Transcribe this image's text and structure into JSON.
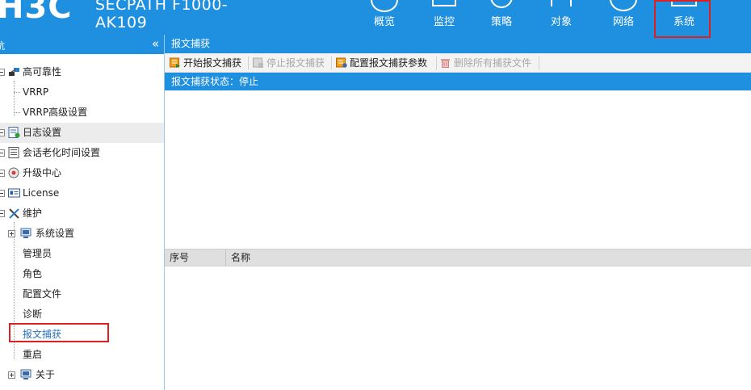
{
  "header": {
    "logo": "H3C",
    "product_line1": "SECPATH F1000-",
    "product_line2": "AK109",
    "nav": [
      {
        "label": "概览",
        "icon": "overview-icon"
      },
      {
        "label": "监控",
        "icon": "monitor-icon"
      },
      {
        "label": "策略",
        "icon": "policy-icon"
      },
      {
        "label": "对象",
        "icon": "object-icon"
      },
      {
        "label": "网络",
        "icon": "network-icon"
      },
      {
        "label": "系统",
        "icon": "system-icon"
      }
    ],
    "active_nav": "系统"
  },
  "sidebar": {
    "title": "航",
    "collapse_glyph": "«",
    "items": [
      {
        "label": "高可靠性",
        "icon": "reliability-icon",
        "expander": "minus"
      },
      {
        "label": "VRRP"
      },
      {
        "label": "VRRP高级设置"
      },
      {
        "label": "日志设置",
        "icon": "log-icon",
        "expander": "minus"
      },
      {
        "label": "会话老化时间设置",
        "icon": "session-icon",
        "expander": "minus"
      },
      {
        "label": "升级中心",
        "icon": "upgrade-icon",
        "expander": "minus"
      },
      {
        "label": "License",
        "icon": "license-icon",
        "expander": "minus"
      },
      {
        "label": "维护",
        "icon": "maintenance-icon",
        "expander": "minus"
      },
      {
        "label": "系统设置",
        "icon": "settings-icon",
        "expander": "plus"
      },
      {
        "label": "管理员"
      },
      {
        "label": "角色"
      },
      {
        "label": "配置文件"
      },
      {
        "label": "诊断"
      },
      {
        "label": "报文捕获"
      },
      {
        "label": "重启"
      },
      {
        "label": "关于",
        "icon": "about-icon",
        "expander": "plus"
      }
    ],
    "selected": "报文捕获"
  },
  "main": {
    "panel_title": "报文捕获",
    "toolbar": [
      {
        "label": "开始报文捕获",
        "icon": "start-capture-icon",
        "enabled": true
      },
      {
        "label": "停止报文捕获",
        "icon": "stop-capture-icon",
        "enabled": false
      },
      {
        "label": "配置报文捕获参数",
        "icon": "configure-capture-icon",
        "enabled": true
      },
      {
        "label": "删除所有捕获文件",
        "icon": "delete-files-icon",
        "enabled": false
      }
    ],
    "status_label": "报文捕获状态：",
    "status_value": "停止",
    "grid_columns": [
      "序号",
      "名称"
    ]
  },
  "colors": {
    "brand_blue": "#1f8fe0",
    "highlight_red": "#e02020",
    "selected_row": "#ececec",
    "toolbar_bg": "#f3f3f3"
  }
}
